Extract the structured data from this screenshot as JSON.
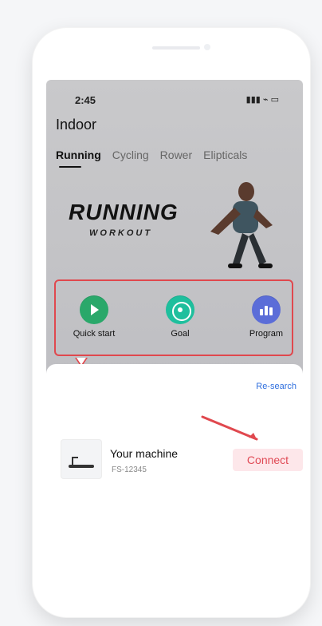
{
  "status": {
    "time": "2:45",
    "icons": "signal wifi battery"
  },
  "header": {
    "title": "Indoor",
    "tabs": [
      {
        "label": "Running",
        "active": true
      },
      {
        "label": "Cycling",
        "active": false
      },
      {
        "label": "Rower",
        "active": false
      },
      {
        "label": "Elipticals",
        "active": false
      }
    ]
  },
  "hero": {
    "headline": "RUNNING",
    "sub": "WORKOUT"
  },
  "actions": [
    {
      "label": "Quick start",
      "icon": "play-icon",
      "color": "#2aa86a"
    },
    {
      "label": "Goal",
      "icon": "target-icon",
      "color": "#1ebf9d"
    },
    {
      "label": "Program",
      "icon": "program-icon",
      "color": "#5b6dd8"
    }
  ],
  "sheet": {
    "research_label": "Re-search",
    "machine": {
      "name": "Your machine",
      "serial": "FS-12345"
    },
    "connect_label": "Connect"
  }
}
